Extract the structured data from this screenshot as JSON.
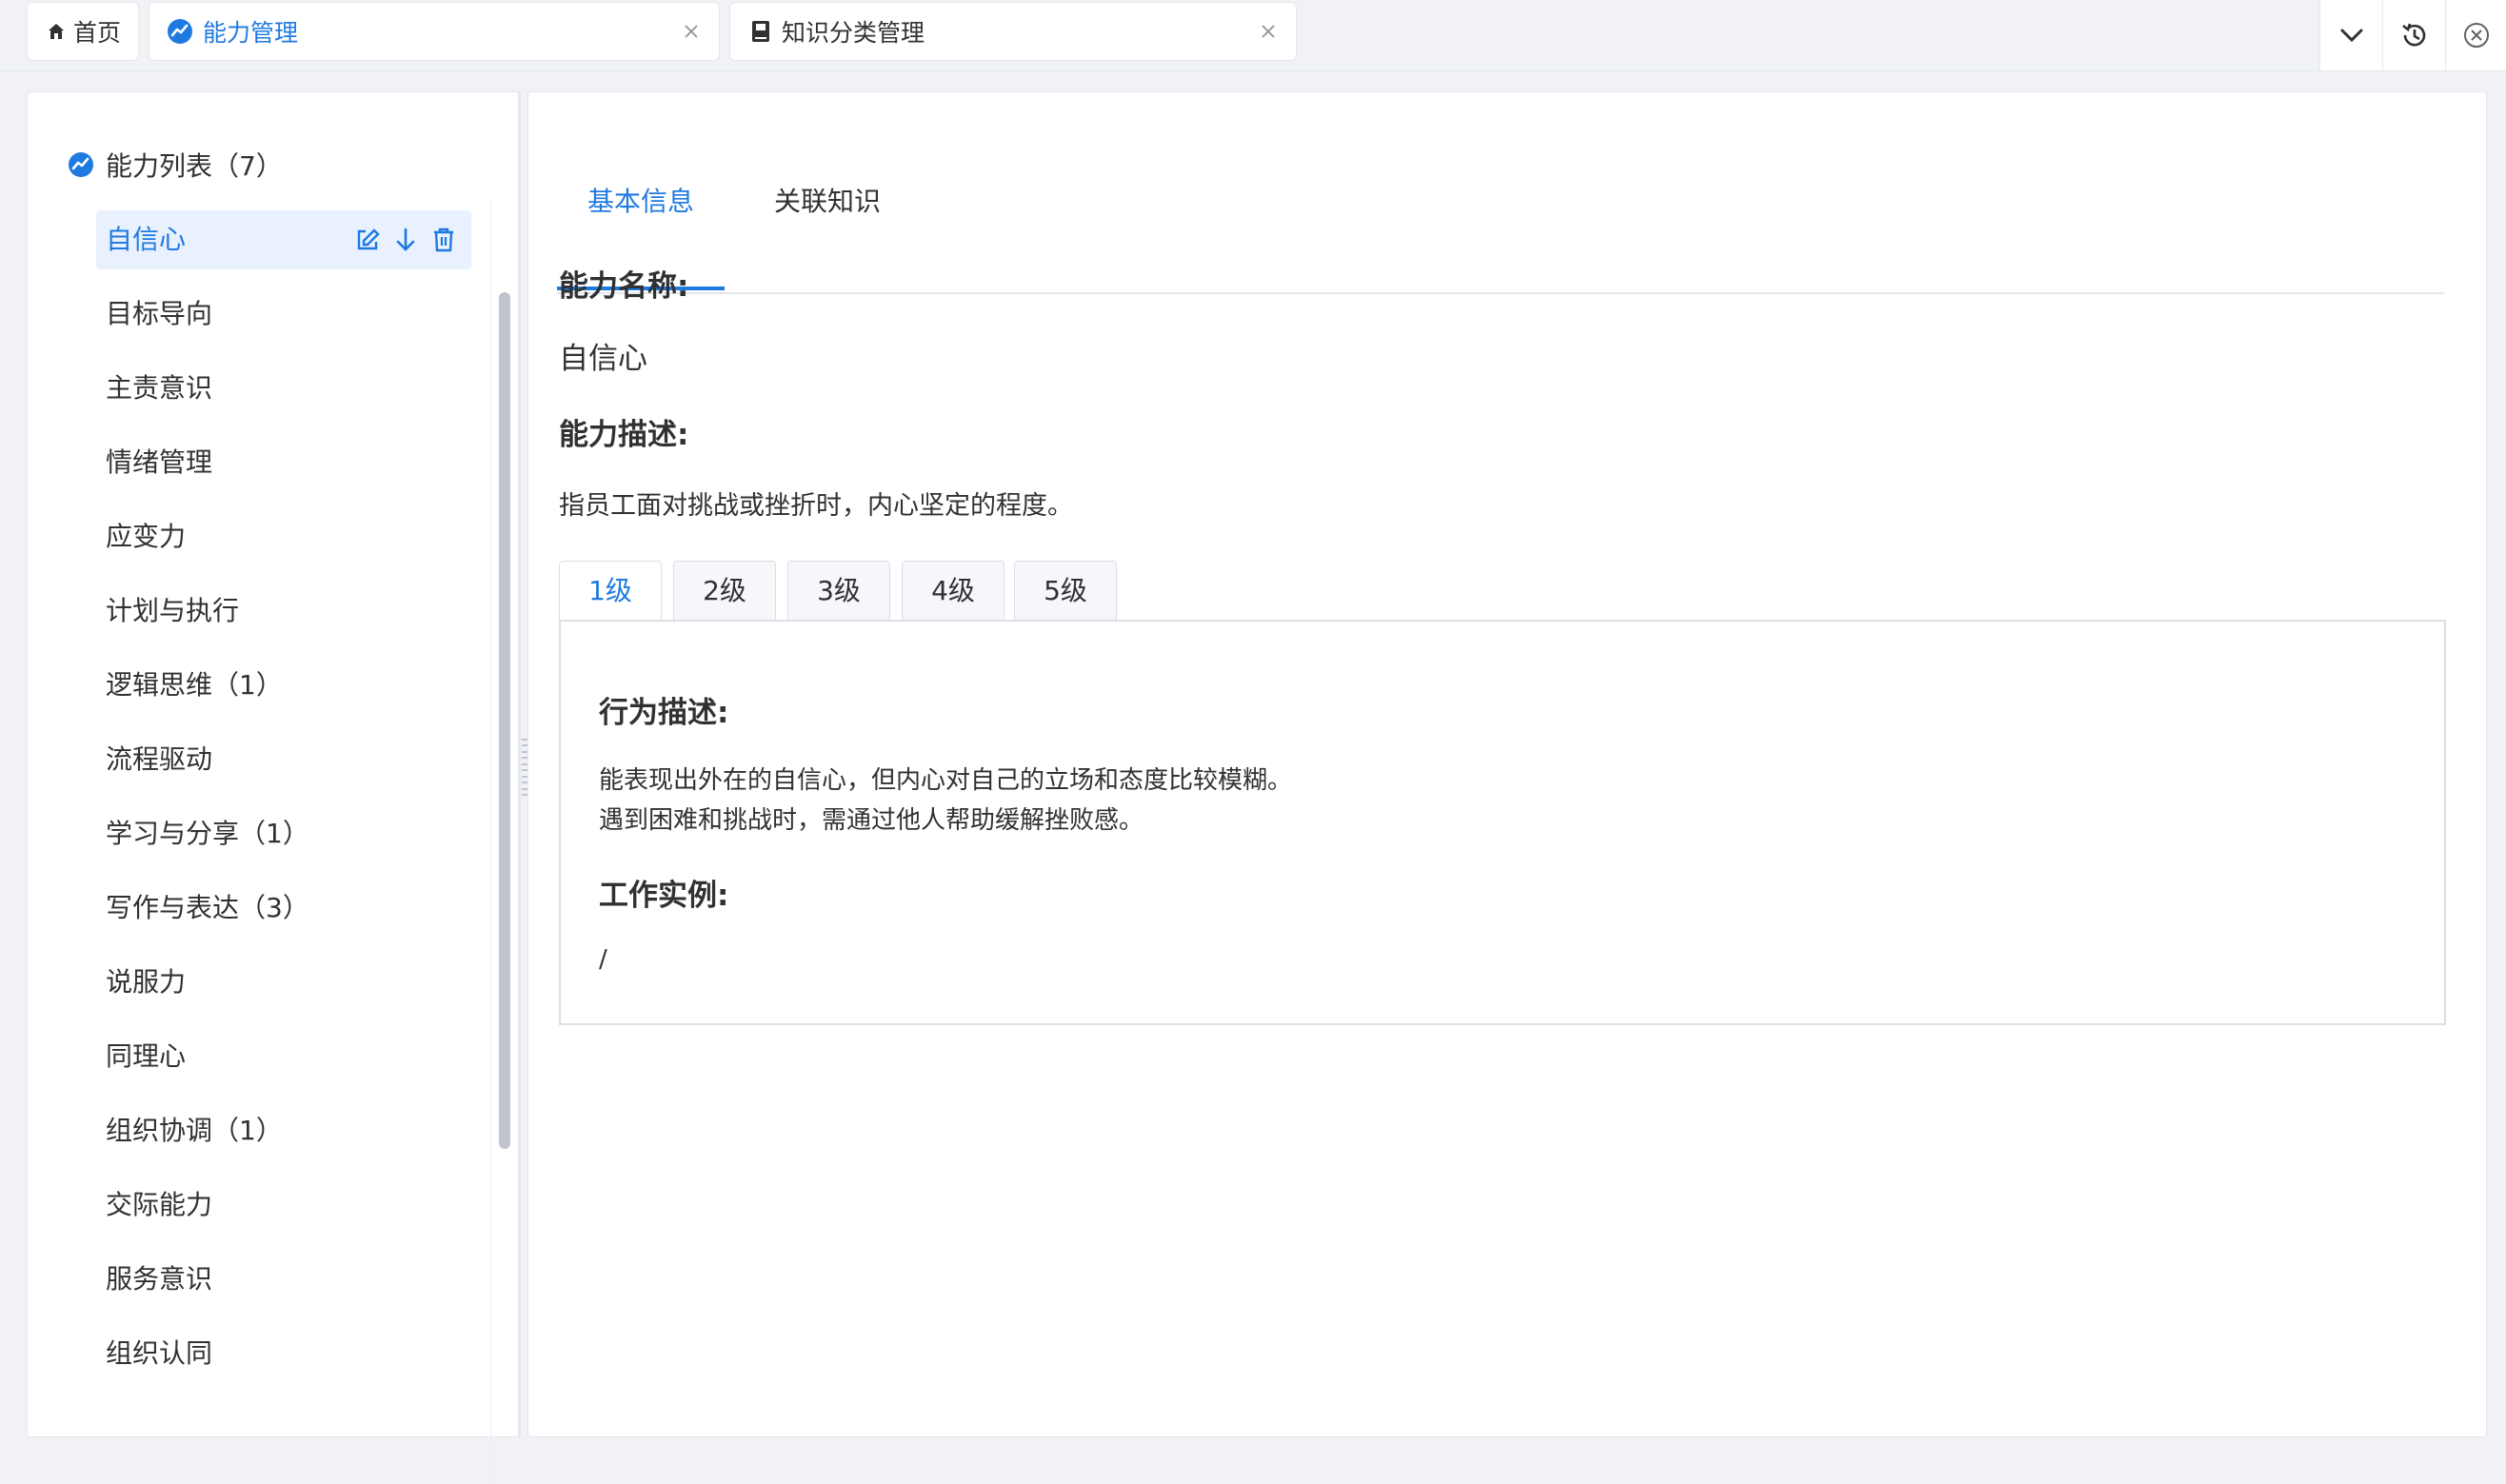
{
  "tabs": [
    {
      "label": "首页",
      "icon": "home-icon"
    },
    {
      "label": "能力管理",
      "icon": "chart-circle-icon",
      "active": true
    },
    {
      "label": "知识分类管理",
      "icon": "book-icon"
    }
  ],
  "toolbar": {
    "icons": [
      "chevron-down-icon",
      "history-icon",
      "close-circle-icon"
    ]
  },
  "sidebar": {
    "root_label": "能力列表（7）",
    "items": [
      {
        "label": "自信心",
        "selected": true
      },
      {
        "label": "目标导向"
      },
      {
        "label": "主责意识"
      },
      {
        "label": "情绪管理"
      },
      {
        "label": "应变力"
      },
      {
        "label": "计划与执行"
      },
      {
        "label": "逻辑思维（1）"
      },
      {
        "label": "流程驱动"
      },
      {
        "label": "学习与分享（1）"
      },
      {
        "label": "写作与表达（3）"
      },
      {
        "label": "说服力"
      },
      {
        "label": "同理心"
      },
      {
        "label": "组织协调（1）"
      },
      {
        "label": "交际能力"
      },
      {
        "label": "服务意识"
      },
      {
        "label": "组织认同"
      }
    ],
    "item_actions": [
      "edit-icon",
      "arrow-down-icon",
      "delete-icon"
    ]
  },
  "detail": {
    "tabs": [
      {
        "label": "基本信息",
        "active": true
      },
      {
        "label": "关联知识"
      }
    ],
    "name_label": "能力名称:",
    "name_value": "自信心",
    "desc_label": "能力描述:",
    "desc_value": "指员工面对挑战或挫折时，内心坚定的程度。",
    "levels": [
      "1级",
      "2级",
      "3级",
      "4级",
      "5级"
    ],
    "active_level": "1级",
    "behavior_label": "行为描述:",
    "behavior_lines": [
      "能表现出外在的自信心，但内心对自己的立场和态度比较模糊。",
      "遇到困难和挑战时，需通过他人帮助缓解挫败感。"
    ],
    "example_label": "工作实例:",
    "example_value": "/"
  },
  "colors": {
    "accent": "#1f7ae0",
    "selected_bg": "#e8f1fd",
    "border": "#e4e7ed"
  }
}
